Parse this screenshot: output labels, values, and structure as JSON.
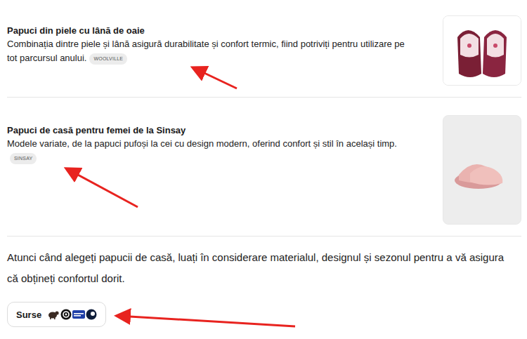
{
  "items": [
    {
      "title": "Papuci din piele cu lână de oaie",
      "description": "Combinația dintre piele și lână asigură durabilitate și confort termic, fiind potriviți pentru utilizare pe tot parcursul anului.",
      "source": "WOOLVILLE"
    },
    {
      "title": "Papuci de casă pentru femei de la Sinsay",
      "description": "Modele variate, de la papuci pufoși la cei cu design modern, oferind confort și stil în același timp.",
      "source": "SINSAY"
    }
  ],
  "summary": "Atunci când alegeți papucii de casă, luați în considerare materialul, designul și sezonul pentru a vă asigura că obțineți confortul dorit.",
  "sources_button": {
    "label": "Surse"
  }
}
